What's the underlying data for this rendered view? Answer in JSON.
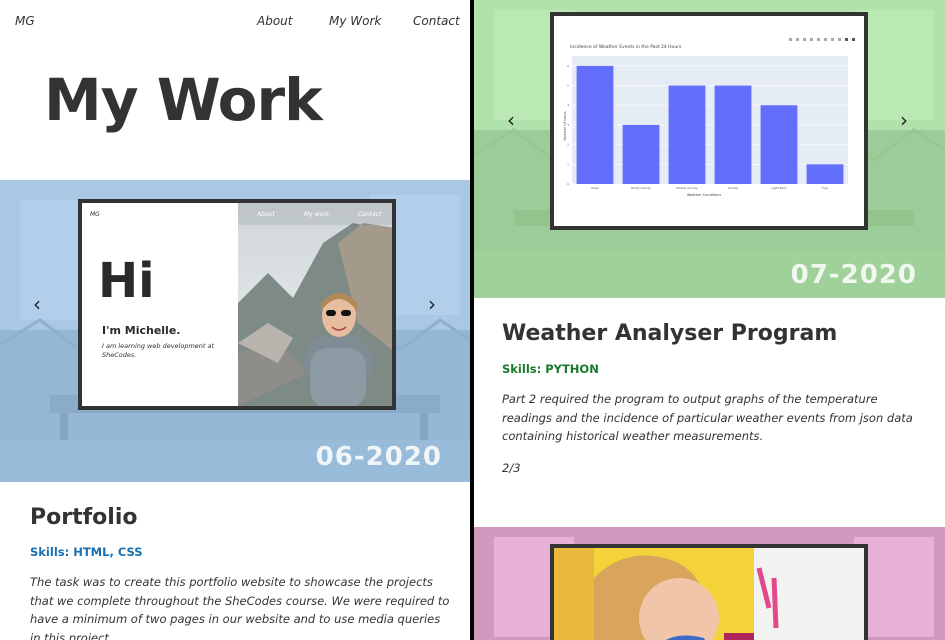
{
  "nav": {
    "brand": "MG",
    "links": [
      "About",
      "My Work",
      "Contact"
    ]
  },
  "page_title": "My Work",
  "projects": [
    {
      "date": "06-2020",
      "title": "Portfolio",
      "skills": "Skills: HTML, CSS",
      "description": "The task was to create this portfolio website to showcase the projects that we complete throughout the SheCodes course. We were required to have a minimum of two pages in our website and to use media queries in this project.",
      "preview": {
        "brand": "MG",
        "links": [
          "About",
          "My work",
          "Contact"
        ],
        "hi": "Hi",
        "name": "I'm Michelle.",
        "tagline": "I am learning web development at SheCodes."
      },
      "overlay_color": "#9dc3e8"
    },
    {
      "date": "07-2020",
      "title": "Weather Analyser Program",
      "skills": "Skills: PYTHON",
      "description": "Part 2 required the program to output graphs of the temperature readings and the incidence of particular weather events from json data containing historical weather measurements.",
      "counter": "2/3",
      "overlay_color": "#a8e6a0"
    },
    {
      "overlay_color": "#e8a0d0"
    }
  ],
  "chart_data": {
    "type": "bar",
    "title": "Incidence of Weather Events in the Past 24 Hours",
    "xlabel": "Weather Conditions",
    "ylabel": "Number of hours",
    "categories": [
      "Clear",
      "Partly Cloudy",
      "Mostly Cloudy",
      "Cloudy",
      "Light Rain",
      "Fog"
    ],
    "values": [
      6,
      3,
      5,
      5,
      4,
      1
    ],
    "ylim": [
      0,
      6.5
    ],
    "color": "#636efa"
  },
  "colors": {
    "skills_left": "#1a6fb0",
    "skills_right": "#1b7a2a"
  }
}
